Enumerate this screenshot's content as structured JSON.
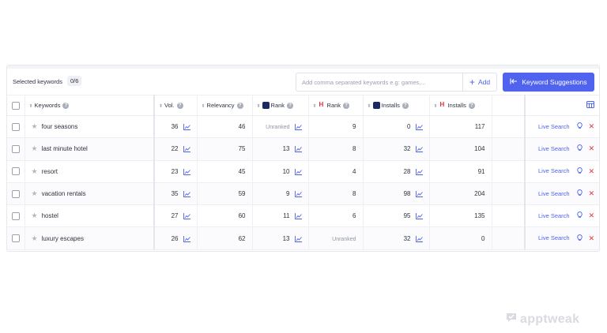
{
  "toolbar": {
    "selected_label": "Selected keywords",
    "selected_count": "0/6",
    "input_placeholder": "Add comma separated keywords e.g: games,...",
    "add_label": "Add",
    "suggestions_label": "Keyword Suggestions"
  },
  "headers": {
    "keywords": "Keywords",
    "volume": "Vol.",
    "relevancy": "Relevancy",
    "rank_a": "Rank",
    "rank_b": "Rank",
    "installs_a": "Installs",
    "installs_b": "Installs"
  },
  "rows": [
    {
      "keyword": "four seasons",
      "vol": "36",
      "relevancy": "46",
      "rank_a": "Unranked",
      "rank_b": "9",
      "installs_a": "0",
      "installs_b": "117",
      "live": "Live Search"
    },
    {
      "keyword": "last minute hotel",
      "vol": "22",
      "relevancy": "75",
      "rank_a": "13",
      "rank_b": "8",
      "installs_a": "32",
      "installs_b": "104",
      "live": "Live Search"
    },
    {
      "keyword": "resort",
      "vol": "23",
      "relevancy": "45",
      "rank_a": "10",
      "rank_b": "4",
      "installs_a": "28",
      "installs_b": "91",
      "live": "Live Search"
    },
    {
      "keyword": "vacation rentals",
      "vol": "35",
      "relevancy": "59",
      "rank_a": "9",
      "rank_b": "8",
      "installs_a": "98",
      "installs_b": "204",
      "live": "Live Search"
    },
    {
      "keyword": "hostel",
      "vol": "27",
      "relevancy": "60",
      "rank_a": "11",
      "rank_b": "6",
      "installs_a": "95",
      "installs_b": "135",
      "live": "Live Search"
    },
    {
      "keyword": "luxury escapes",
      "vol": "26",
      "relevancy": "62",
      "rank_a": "13",
      "rank_b": "Unranked",
      "installs_a": "32",
      "installs_b": "0",
      "live": "Live Search"
    }
  ],
  "watermark": "apptweak",
  "colors": {
    "accent": "#4f63ef",
    "delete": "#e0323d",
    "brand_blue": "#1a2a63"
  }
}
